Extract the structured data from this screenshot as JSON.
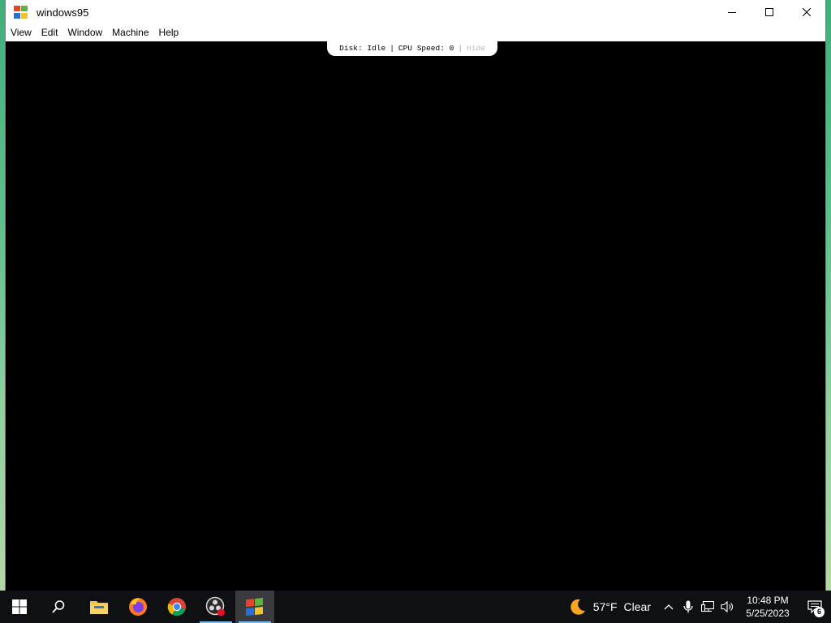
{
  "window": {
    "title": "windows95",
    "icon": "windows95-logo-icon",
    "controls": [
      "minimize-icon",
      "maximize-icon",
      "close-icon"
    ]
  },
  "menubar": {
    "items": [
      "View",
      "Edit",
      "Window",
      "Machine",
      "Help"
    ]
  },
  "status_bar": {
    "disk_label": "Disk: Idle",
    "separator": "|",
    "cpu_label": "CPU Speed: 0",
    "hide_label": "Hide"
  },
  "taskbar": {
    "start": "windows-start-icon",
    "search": "search-icon",
    "pinned": [
      "file-explorer-icon",
      "firefox-icon",
      "chrome-icon",
      "obs-icon",
      "windows95-app-icon"
    ],
    "weather": {
      "icon": "moon-icon",
      "temperature": "57°F",
      "condition": "Clear"
    },
    "tray_icons": [
      "chevron-up-icon",
      "microphone-icon",
      "network-icon",
      "volume-icon"
    ],
    "time": "10:48 PM",
    "date": "5/25/2023",
    "notification_count": "6"
  },
  "colors": {
    "accent_underline": "#76b9ed",
    "taskbar": "#0f1013",
    "screen": "#000000"
  }
}
